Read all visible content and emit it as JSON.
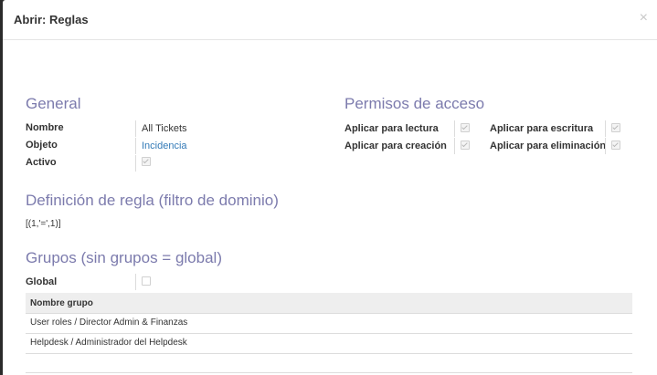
{
  "modal": {
    "title": "Abrir: Reglas",
    "close_label": "×"
  },
  "general": {
    "title": "General",
    "fields": [
      {
        "label": "Nombre",
        "value": "All Tickets"
      },
      {
        "label": "Objeto",
        "value": "Incidencia"
      },
      {
        "label": "Activo",
        "checked": true
      }
    ]
  },
  "access": {
    "title": "Permisos de acceso",
    "read_label": "Aplicar para lectura",
    "create_label": "Aplicar para creación",
    "write_label": "Aplicar para escritura",
    "unlink_label": "Aplicar para eliminación",
    "read": true,
    "create": true,
    "write": true,
    "unlink": true
  },
  "domain": {
    "title": "Definición de regla (filtro de dominio)",
    "value": "[(1,'=',1)]"
  },
  "groups": {
    "title": "Grupos (sin grupos = global)",
    "global_label": "Global",
    "global_checked": false,
    "column_header": "Nombre grupo",
    "rows": [
      "User roles / Director Admin & Finanzas",
      "Helpdesk / Administrador del Helpdesk"
    ]
  },
  "colors": {
    "section_title": "#7c7bad",
    "link": "#337ab7"
  }
}
